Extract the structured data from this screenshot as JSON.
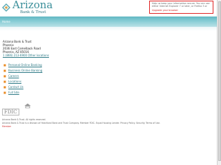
{
  "header": {
    "brand_name": "Arizona",
    "brand_sub": "Bank & Trust",
    "brand_color": "#3b8f9a",
    "logo_icon": "arizona-bank-mark-icon"
  },
  "notice": {
    "text": "Help us keep your information secure. You can use either Internet Explorer 7 or later, or Firefox 3 or later with this website.",
    "link_label": "Upgrade your browser",
    "border_color": "#df2020"
  },
  "nav": {
    "label": "Home",
    "band_color": "#61b8c3"
  },
  "contact": {
    "lines": [
      "Arizona Bank & Trust",
      "Phoenix",
      "2036 East Camelback Road",
      "Phoenix, AZ 85016"
    ],
    "phone_link": "1 (866) 213-6900   Other locations"
  },
  "links": [
    {
      "label": "Personal Online Banking",
      "icon": "bullet-icon"
    },
    {
      "label": "Business Online Banking",
      "icon": "bullet-icon"
    },
    {
      "label": "Careers",
      "icon": "bullet-icon"
    },
    {
      "label": "Locations",
      "icon": "bullet-icon"
    },
    {
      "label": "Contact Us",
      "icon": "bullet-icon"
    },
    {
      "label": "Full Site",
      "icon": "bullet-icon"
    }
  ],
  "footer": {
    "fdic_text": "FDIC",
    "equal_housing_icon": "equal-housing-lender-icon",
    "copyright": "Arizona Bank & Trust. All rights reserved.",
    "disclaimer": "Arizona Bank & Trust is a division of Heartland Bank and Trust Company. Member FDIC. Equal Housing Lender. Privacy Policy. Security. Terms of Use.",
    "member_label": "Member"
  }
}
